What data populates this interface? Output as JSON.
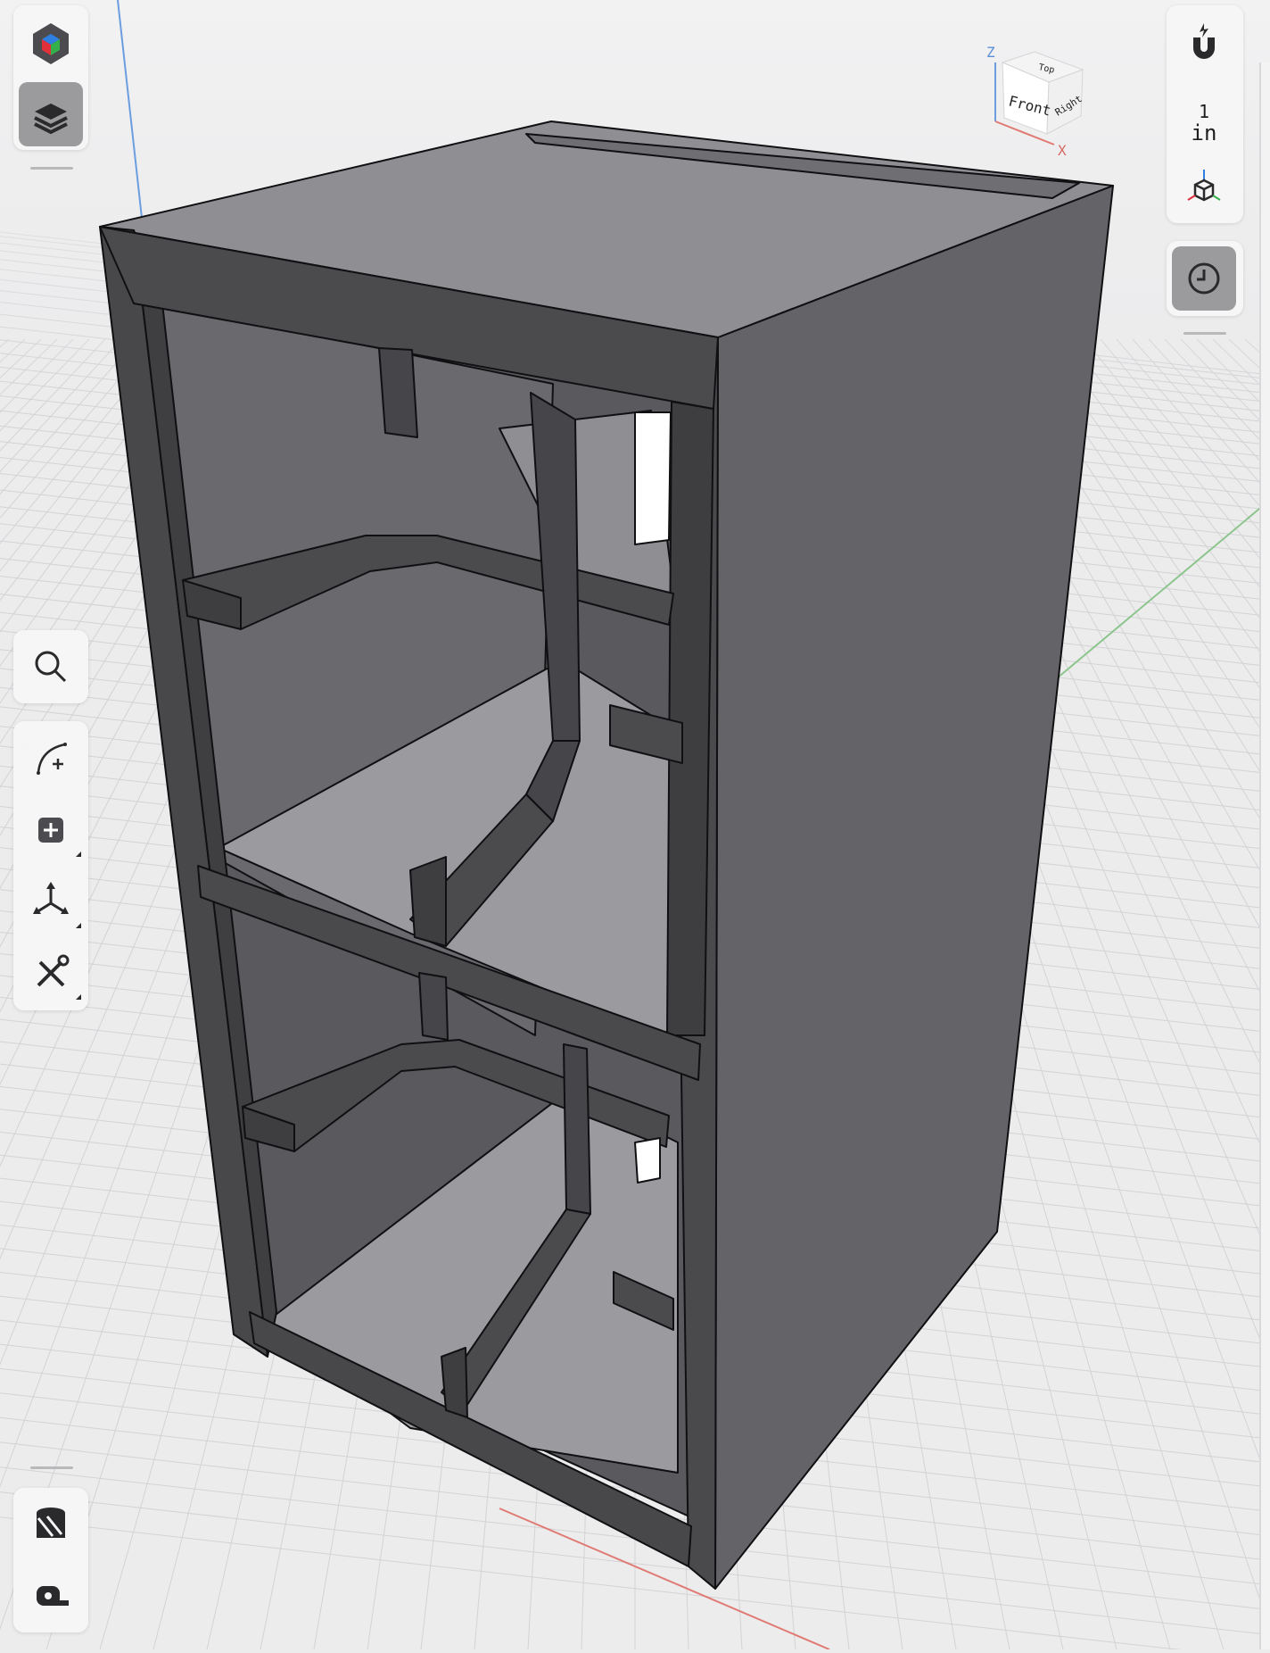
{
  "view_cube": {
    "top": "Top",
    "front": "Front",
    "right": "Right",
    "axis_z": "Z",
    "axis_x": "X"
  },
  "units": {
    "value": "1",
    "unit": "in"
  },
  "left_toolbar": {
    "top_tools": [
      "app-logo-icon",
      "layers-icon"
    ],
    "middle_tools": [
      "search-icon",
      "sketch-curve-icon",
      "add-object-icon",
      "transform-icon",
      "tools-icon"
    ],
    "bottom_tools": [
      "materials-icon",
      "measure-tape-icon"
    ]
  },
  "right_toolbar": {
    "tools": [
      "snap-magnet-icon",
      "units-toggle",
      "view-gizmo-icon",
      "history-clock-icon"
    ]
  },
  "colors": {
    "background": "#ececed",
    "grid": "#d6d6d8",
    "axis_x": "#e07a72",
    "axis_y": "#8cc58c",
    "axis_z": "#6b9de0",
    "body_dark": "#4a4a4d",
    "body_side": "#646468",
    "interior": "#8e8e93",
    "active_tool": "#9b9b9e"
  }
}
